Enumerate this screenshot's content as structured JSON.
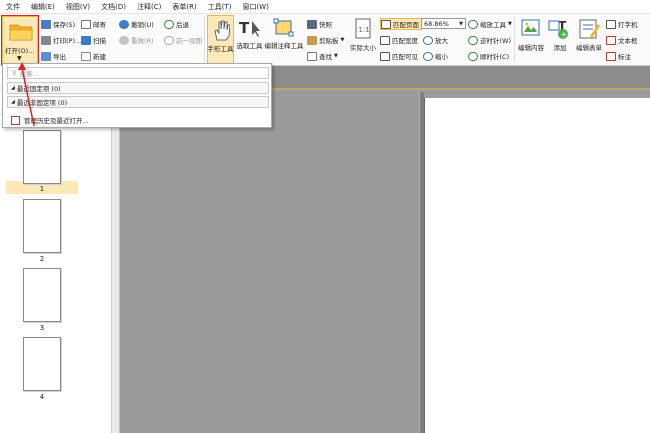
{
  "menu": [
    "文件",
    "编辑(E)",
    "视图(V)",
    "文档(D)",
    "注释(C)",
    "表单(R)",
    "工具(T)",
    "窗口(W)"
  ],
  "ribbon": {
    "open_label": "打开(O)...",
    "save": "保存(S)",
    "print": "打印(P)...",
    "export": "导出",
    "email": "邮寄",
    "scan": "扫描",
    "new": "新建",
    "undo": "撤销(U)",
    "redo": "重做(R)",
    "back": "后退",
    "prev_view": "前一视图",
    "hand_tool": "手形工具",
    "select_tool": "选取工具",
    "annot_select_tool": "编辑注释工具",
    "snapshot": "快照",
    "clipboard": "剪贴板",
    "find": "查找",
    "actual_size": "实际大小",
    "fit_page": "匹配页面",
    "fit_width": "匹配宽度",
    "fit_visible": "匹配可见",
    "zoom_value": "68.86%",
    "zoom_tool": "缩放工具",
    "zoom_in": "放大",
    "zoom_out": "缩小",
    "rotate_ccw": "逆时针(W)",
    "rotate_cw": "顺时针(C)",
    "edit_content": "编辑内容",
    "add": "添加",
    "edit_form": "编辑表单",
    "typewriter": "打字机",
    "textbox": "文本框",
    "callout": "标注"
  },
  "dropdown": {
    "search_placeholder": "搜索...",
    "pinned_label": "最近固定项 (0)",
    "unpinned_label": "最近非固定项 (0)",
    "manage_label": "管理历史及最近打开..."
  },
  "thumbs": [
    "1",
    "2",
    "3",
    "4"
  ],
  "colors": {
    "highlight": "#e02020",
    "selected": "#fde9b8",
    "folder": "#f5b423"
  }
}
